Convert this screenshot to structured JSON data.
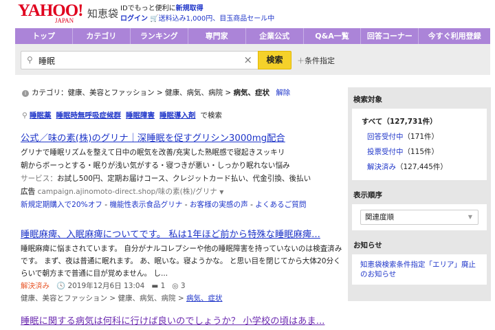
{
  "header": {
    "logo": "YAHOO! JAPAN",
    "service": "知恵袋",
    "promo_line1_prefix": "IDでもっと便利に",
    "promo_line1_link": "新規取得",
    "login": "ログイン",
    "promo_line2": "送料込み1,000円、目玉商品セール中"
  },
  "nav": [
    "トップ",
    "カテゴリ",
    "ランキング",
    "専門家",
    "企業公式",
    "Q&A一覧",
    "回答コーナー",
    "今すぐ利用登録"
  ],
  "search": {
    "value": "睡眠",
    "button": "検索",
    "conditions": "条件指定"
  },
  "category": {
    "label": "カテゴリ：",
    "path1": "健康、美容とファッション",
    "path2": "健康、病気、病院",
    "current": "病気、症状",
    "clear": "解除"
  },
  "related": {
    "items": [
      "睡眠薬",
      "睡眠時無呼吸症候群",
      "睡眠障害",
      "睡眠導入剤"
    ],
    "suffix": "で検索"
  },
  "ad": {
    "title": "公式／味の素(株)のグリナ｜深睡眠を促すグリシン3000mg配合",
    "desc1": "グリナで睡眠リズムを整えて日中の眠気を改善/充実した熟眠感で寝起きスッキリ",
    "desc2": "朝からボーっとする・眠りが浅い気がする・寝つきが悪い・しっかり眠れない悩み",
    "service_label": "サービス：",
    "service": "お試し500円、定期お届けコース、クレジットカード払い、代金引換、後払い",
    "ad_label": "広告",
    "url": "campaign.ajinomoto-direct.shop/味の素(株)/グリナ",
    "links": [
      "新規定期購入で20%オフ",
      "機能性表示食品グリナ",
      "お客様の実感の声",
      "よくあるご質問"
    ]
  },
  "results": [
    {
      "title": "睡眠麻痺、入眠麻痺についてです。 私は1年ほど前から特殊な睡眠麻痺...",
      "body": "睡眠麻痺に悩まされています。 自分がナルコレプシーや他の睡眠障害を持っていないのは検査済みです。 まず、夜は普通に眠れます。 あ、眠いな。寝ようかな。 と思い目を閉じてから大体20分くらいで朝方まで普通に目が覚めません。 し...",
      "status": "解決済み",
      "date": "2019年12月6日 13:04",
      "answers": "1",
      "views": "3",
      "cat1": "健康、美容とファッション",
      "cat2": "健康、病気、病院",
      "cat3": "病気、症状"
    },
    {
      "title": "睡眠に関する病気は何科に行けば良いのでしょうか？ 小学校の頃はあま..."
    }
  ],
  "sidebar": {
    "target_title": "検索対象",
    "all": "すべて（127,731件）",
    "items": [
      {
        "label": "回答受付中",
        "count": "（171件）"
      },
      {
        "label": "投票受付中",
        "count": "（115件）"
      },
      {
        "label": "解決済み",
        "count": "（127,445件）"
      }
    ],
    "order_title": "表示順序",
    "order_value": "関連度順",
    "notice_title": "お知らせ",
    "notice_link": "知恵袋検索条件指定「エリア」廃止のお知らせ"
  }
}
